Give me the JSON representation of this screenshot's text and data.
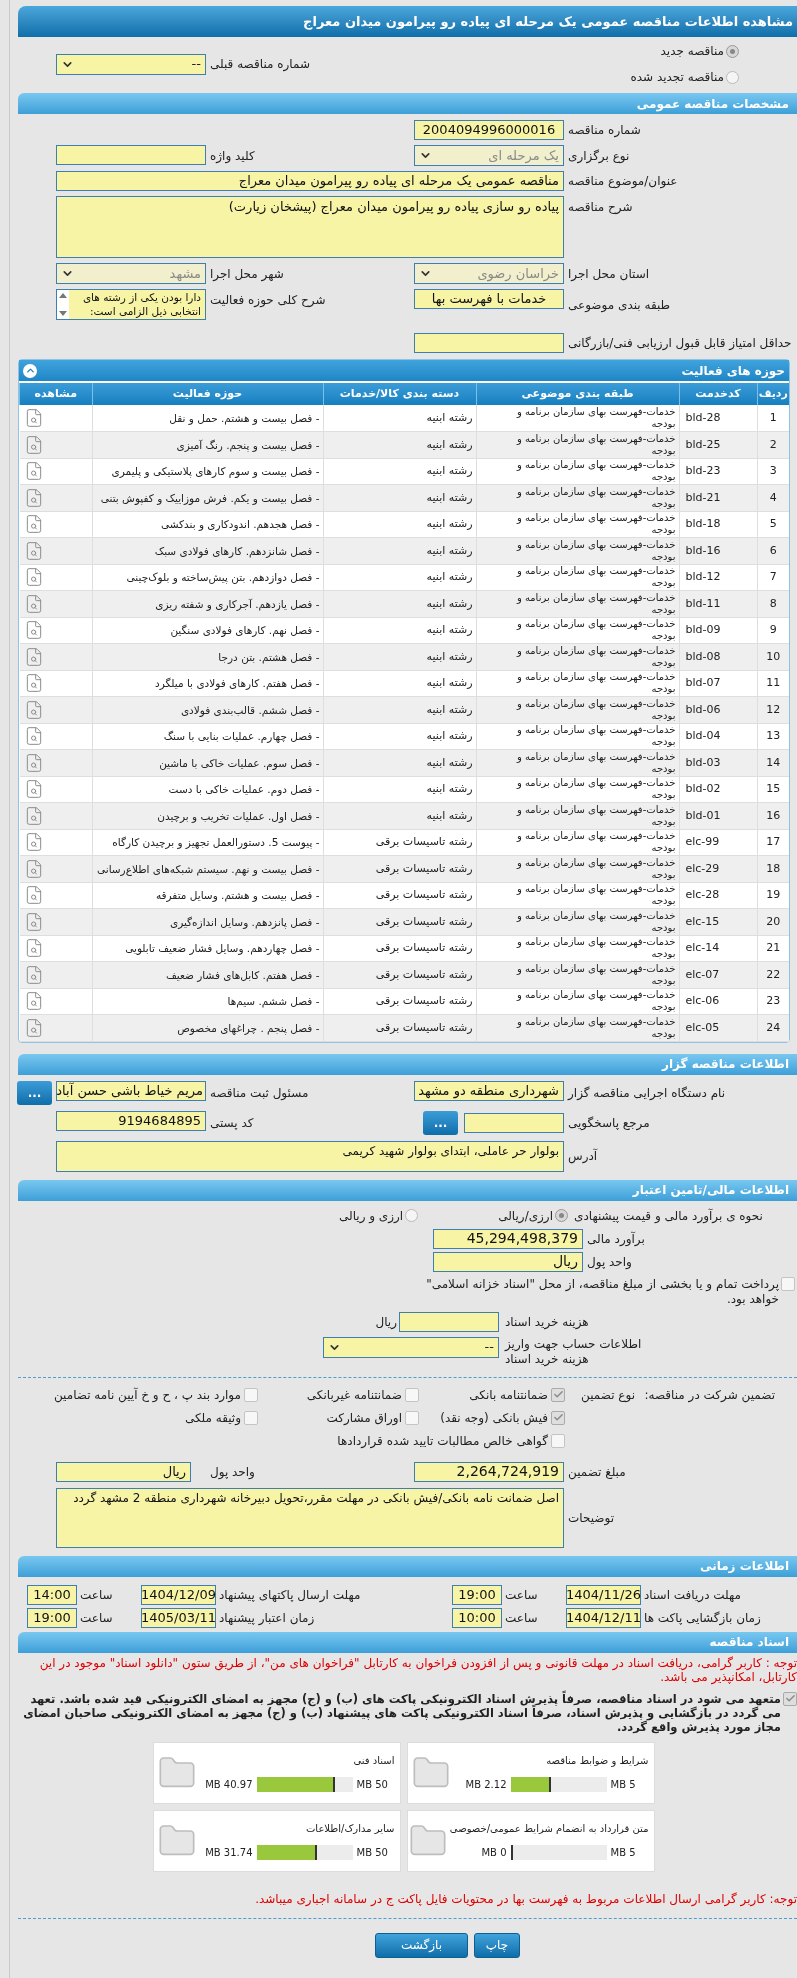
{
  "page_title": "مشاهده اطلاعات مناقصه عمومی یک مرحله ای پیاده رو پیرامون میدان معراج",
  "tender_kind": [
    {
      "label": "مناقصه جدید",
      "selected": true
    },
    {
      "label": "مناقصه تجدید شده",
      "selected": false
    }
  ],
  "previous_tender": {
    "label": "شماره مناقصه قبلی",
    "value": "--"
  },
  "general": {
    "header": "مشخصات مناقصه عمومی",
    "rows": [
      [
        {
          "kind": "input",
          "label": "شماره مناقصه",
          "value": "2004094996000016"
        }
      ],
      [
        {
          "kind": "select",
          "label": "نوع برگزاری",
          "value": "یک مرحله ای",
          "disabled": true
        },
        {
          "kind": "input",
          "label": "کلید واژه"
        }
      ],
      [
        {
          "kind": "wide",
          "label": "عنوان/موضوع مناقصه",
          "value": "مناقصه عمومی یک مرحله ای پیاده رو پیرامون میدان معراج"
        }
      ],
      [
        {
          "kind": "textarea",
          "label": "شرح مناقصه",
          "value": "پیاده رو سازی پیاده رو پیرامون میدان معراج (پیشخان زیارت)"
        }
      ],
      [
        {
          "kind": "select",
          "label": "استان محل اجرا",
          "value": "خراسان رضوی",
          "disabled": true
        },
        {
          "kind": "select",
          "label": "شهر محل اجرا",
          "value": "مشهد",
          "disabled": true
        }
      ],
      [
        {
          "kind": "input",
          "label": "طبقه بندی موضوعی",
          "value": "خدمات با فهرست بها"
        },
        {
          "kind": "listbox",
          "label": "شرح کلی حوزه فعالیت",
          "value": "دارا بودن یکی از رشته های انتخابی ذیل الزامی است:"
        }
      ],
      [
        {
          "kind": "input",
          "label": "حداقل امتیاز قابل قبول ارزیابی فنی/بازرگانی"
        }
      ]
    ]
  },
  "activities": {
    "header": "حوزه های فعالیت",
    "expanded": true,
    "columns": [
      "ردیف",
      "کدخدمت",
      "طبقه بندی موضوعی",
      "دسته بندی کالا/خدمات",
      "حوزه فعالیت",
      "مشاهده"
    ],
    "rows": [
      {
        "index": "1",
        "code": "bld-28",
        "category": "خدمات-فهرست بهای سازمان برنامه و بودجه",
        "group": "رشته ابنیه",
        "activity": "- فصل بیست و هشتم. حمل و نقل"
      },
      {
        "index": "2",
        "code": "bld-25",
        "category": "خدمات-فهرست بهای سازمان برنامه و بودجه",
        "group": "رشته ابنیه",
        "activity": "- فصل بیست و پنجم. رنگ آمیزی"
      },
      {
        "index": "3",
        "code": "bld-23",
        "category": "خدمات-فهرست بهای سازمان برنامه و بودجه",
        "group": "رشته ابنیه",
        "activity": "- فصل بیست و سوم کارهای پلاستیکی و پلیمری"
      },
      {
        "index": "4",
        "code": "bld-21",
        "category": "خدمات-فهرست بهای سازمان برنامه و بودجه",
        "group": "رشته ابنیه",
        "activity": "- فصل بیست و یکم. فرش موزاییک و کفپوش بتنی"
      },
      {
        "index": "5",
        "code": "bld-18",
        "category": "خدمات-فهرست بهای سازمان برنامه و بودجه",
        "group": "رشته ابنیه",
        "activity": "- فصل هجدهم. اندودکاری و بندکشی"
      },
      {
        "index": "6",
        "code": "bld-16",
        "category": "خدمات-فهرست بهای سازمان برنامه و بودجه",
        "group": "رشته ابنیه",
        "activity": "- فصل شانزدهم. کارهای فولادی سبک"
      },
      {
        "index": "7",
        "code": "bld-12",
        "category": "خدمات-فهرست بهای سازمان برنامه و بودجه",
        "group": "رشته ابنیه",
        "activity": "- فصل دوازدهم. بتن پیش‌ساخته و بلوک‌چینی"
      },
      {
        "index": "8",
        "code": "bld-11",
        "category": "خدمات-فهرست بهای سازمان برنامه و بودجه",
        "group": "رشته ابنیه",
        "activity": "- فصل یازدهم. آجرکاری و شفته ریزی"
      },
      {
        "index": "9",
        "code": "bld-09",
        "category": "خدمات-فهرست بهای سازمان برنامه و بودجه",
        "group": "رشته ابنیه",
        "activity": "- فصل نهم. کارهای فولادی سنگین"
      },
      {
        "index": "10",
        "code": "bld-08",
        "category": "خدمات-فهرست بهای سازمان برنامه و بودجه",
        "group": "رشته ابنیه",
        "activity": "- فصل هشتم. بتن درجا"
      },
      {
        "index": "11",
        "code": "bld-07",
        "category": "خدمات-فهرست بهای سازمان برنامه و بودجه",
        "group": "رشته ابنیه",
        "activity": "- فصل هفتم. کارهای فولادی با میلگرد"
      },
      {
        "index": "12",
        "code": "bld-06",
        "category": "خدمات-فهرست بهای سازمان برنامه و بودجه",
        "group": "رشته ابنیه",
        "activity": "- فصل ششم. قالب‌بندی فولادی"
      },
      {
        "index": "13",
        "code": "bld-04",
        "category": "خدمات-فهرست بهای سازمان برنامه و بودجه",
        "group": "رشته ابنیه",
        "activity": "- فصل چهارم. عملیات بنایی با سنگ"
      },
      {
        "index": "14",
        "code": "bld-03",
        "category": "خدمات-فهرست بهای سازمان برنامه و بودجه",
        "group": "رشته ابنیه",
        "activity": "- فصل سوم. عملیات خاکی با ماشین"
      },
      {
        "index": "15",
        "code": "bld-02",
        "category": "خدمات-فهرست بهای سازمان برنامه و بودجه",
        "group": "رشته ابنیه",
        "activity": "- فصل دوم. عملیات خاکی با دست"
      },
      {
        "index": "16",
        "code": "bld-01",
        "category": "خدمات-فهرست بهای سازمان برنامه و بودجه",
        "group": "رشته ابنیه",
        "activity": "- فصل اول. عملیات تخریب و برچیدن"
      },
      {
        "index": "17",
        "code": "elc-99",
        "category": "خدمات-فهرست بهای سازمان برنامه و بودجه",
        "group": "رشته تاسیسات برقی",
        "activity": "- پیوست 5. دستورالعمل تجهیز و برچیدن کارگاه"
      },
      {
        "index": "18",
        "code": "elc-29",
        "category": "خدمات-فهرست بهای سازمان برنامه و بودجه",
        "group": "رشته تاسیسات برقی",
        "activity": "- فصل بیست و نهم. سیستم شبکه‌های اطلاع‌رسانی"
      },
      {
        "index": "19",
        "code": "elc-28",
        "category": "خدمات-فهرست بهای سازمان برنامه و بودجه",
        "group": "رشته تاسیسات برقی",
        "activity": "- فصل بیست و هشتم. وسایل متفرقه"
      },
      {
        "index": "20",
        "code": "elc-15",
        "category": "خدمات-فهرست بهای سازمان برنامه و بودجه",
        "group": "رشته تاسیسات برقی",
        "activity": "- فصل پانزدهم. وسایل اندازه‌گیری"
      },
      {
        "index": "21",
        "code": "elc-14",
        "category": "خدمات-فهرست بهای سازمان برنامه و بودجه",
        "group": "رشته تاسیسات برقی",
        "activity": "- فصل چهاردهم. وسایل فشار ضعیف تابلویی"
      },
      {
        "index": "22",
        "code": "elc-07",
        "category": "خدمات-فهرست بهای سازمان برنامه و بودجه",
        "group": "رشته تاسیسات برقی",
        "activity": "- فصل هفتم. کابل‌های فشار ضعیف"
      },
      {
        "index": "23",
        "code": "elc-06",
        "category": "خدمات-فهرست بهای سازمان برنامه و بودجه",
        "group": "رشته تاسیسات برقی",
        "activity": "- فصل ششم. سیم‌ها"
      },
      {
        "index": "24",
        "code": "elc-05",
        "category": "خدمات-فهرست بهای سازمان برنامه و بودجه",
        "group": "رشته تاسیسات برقی",
        "activity": "- فصل پنجم . چراغهای مخصوص"
      }
    ]
  },
  "organizer": {
    "header": "اطلاعات مناقصه گزار",
    "agency": {
      "label": "نام دستگاه اجرایی مناقصه گزار",
      "value": "شهرداری منطقه دو مشهد"
    },
    "registrar": {
      "label": "مسئول ثبت مناقصه",
      "value": "مریم خیاط باشی حسن آباد",
      "button": "..."
    },
    "reference": {
      "label": "مرجع پاسخگویی",
      "button": "..."
    },
    "postal_code": {
      "label": "کد پستی",
      "value": "9194684895"
    },
    "address": {
      "label": "آدرس",
      "value": "بولوار حر عاملی، ابتدای بولوار شهید کریمی"
    }
  },
  "finance": {
    "header": "اطلاعات مالی/تامین اعتبار",
    "estimate_method": {
      "label": "نحوه ی برآورد مالی و قیمت پیشنهادی",
      "options": [
        {
          "label": "ارزی/ریالی",
          "selected": true
        },
        {
          "label": "ارزی و ریالی",
          "selected": false
        }
      ]
    },
    "estimate": {
      "label": "برآورد مالی",
      "value": "45,294,498,379"
    },
    "currency": {
      "label": "واحد پول",
      "value": "ریال"
    },
    "treasury": {
      "label": "پرداخت تمام و یا بخشی از مبلغ مناقصه، از محل \"اسناد خزانه اسلامی\" خواهد بود.",
      "checked": false
    },
    "document_fee": {
      "label": "هزینه خرید اسناد",
      "unit": "ریال"
    },
    "fee_account": {
      "label": "اطلاعات حساب جهت واریز هزینه خرید اسناد",
      "value": "--"
    }
  },
  "guarantee": {
    "label": "تضمین شرکت در مناقصه:",
    "type_label": "نوع تضمین",
    "options": [
      {
        "label": "ضمانتنامه بانکی",
        "checked": true
      },
      {
        "label": "ضمانتنامه غیربانکی",
        "checked": false
      },
      {
        "label": "موارد بند پ ، ح و خ آیین نامه تضامین",
        "checked": false
      },
      {
        "label": "فیش بانکی (وجه نقد)",
        "checked": true
      },
      {
        "label": "اوراق مشارکت",
        "checked": false
      },
      {
        "label": "وثیقه ملکی",
        "checked": false
      },
      {
        "label": "گواهی خالص مطالبات تایید شده قراردادها",
        "checked": false
      }
    ],
    "amount": {
      "label": "مبلغ تضمین",
      "value": "2,264,724,919"
    },
    "currency": {
      "label": "واحد پول",
      "value": "ریال"
    },
    "notes": {
      "label": "توضیحات",
      "value": "اصل ضمانت نامه بانکی/فیش بانکی در مهلت مقرر،تحویل دبیرخانه شهرداری منطقه 2 مشهد گردد"
    }
  },
  "timing": {
    "header": "اطلاعات زمانی",
    "items": [
      {
        "label": "مهلت دریافت اسناد",
        "date": "1404/11/26",
        "time_label": "ساعت",
        "time": "19:00"
      },
      {
        "label": "مهلت ارسال پاکتهای پیشنهاد",
        "date": "1404/12/09",
        "time_label": "ساعت",
        "time": "14:00"
      },
      {
        "label": "زمان بازگشایی پاکت ها",
        "date": "1404/12/11",
        "time_label": "ساعت",
        "time": "10:00"
      },
      {
        "label": "زمان اعتبار پیشنهاد",
        "date": "1405/03/11",
        "time_label": "ساعت",
        "time": "19:00"
      }
    ]
  },
  "documents": {
    "header": "اسناد مناقصه",
    "notice": "توجه : کاربر گرامی، دریافت اسناد در مهلت قانونی و پس از افزودن فراخوان به کارتابل \"فراخوان های من\"، از طریق ستون \"دانلود اسناد\" موجود در این کارتابل، امکانپذیر می باشد.",
    "commitment": {
      "text": "متعهد می شود در اسناد مناقصه، صرفاً پذیرش اسناد الکترونیکی پاکت های (ب) و (ج) مجهز به امضای الکترونیکی قید شده باشد. تعهد می گردد در بازگشایی و پذیرش اسناد، صرفاً اسناد الکترونیکی پاکت های پیشنهاد (ب) و (ج) مجهز به امضای الکترونیکی صاحبان امضای مجاز مورد پذیرش واقع گردد.",
      "checked": true
    },
    "files": [
      {
        "name": "شرایط و ضوابط مناقصه",
        "max": "5 MB",
        "used": "2.12 MB",
        "level": 0.424
      },
      {
        "name": "اسناد فنی",
        "max": "50 MB",
        "used": "40.97 MB",
        "level": 0.819
      },
      {
        "name": "متن قرارداد به انضمام شرایط عمومی/خصوصی",
        "max": "5 MB",
        "used": "0 MB",
        "level": 0
      },
      {
        "name": "سایر مدارک/اطلاعات",
        "max": "50 MB",
        "used": "31.74 MB",
        "level": 0.635
      }
    ],
    "note": "توجه: کاربر گرامی ارسال اطلاعات مربوط به فهرست بها در محتویات فایل پاکت ج در سامانه اجباری میباشد."
  },
  "buttons": [
    "چاپ",
    "بازگشت"
  ]
}
